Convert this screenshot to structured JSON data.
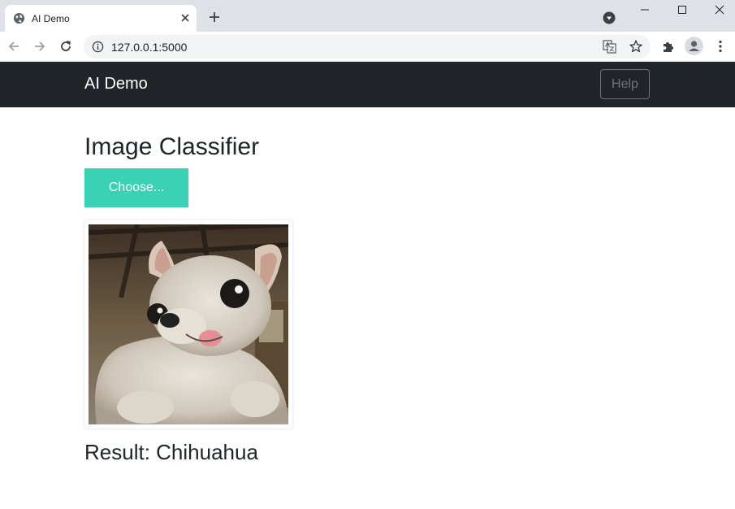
{
  "browser": {
    "tab_title": "AI Demo",
    "url": "127.0.0.1:5000",
    "icons": [
      "globe-icon",
      "close-icon",
      "plus-icon",
      "tab-search-icon",
      "minimize-icon",
      "maximize-icon",
      "window-close-icon",
      "back-icon",
      "forward-icon",
      "reload-icon",
      "info-icon",
      "translate-icon",
      "star-icon",
      "extensions-icon",
      "profile-icon",
      "menu-icon"
    ]
  },
  "navbar": {
    "brand": "AI Demo",
    "help_label": "Help",
    "background": "#212529"
  },
  "main": {
    "title": "Image Classifier",
    "choose_label": "Choose...",
    "choose_color": "#39d2b4",
    "result_prefix": "Result:",
    "result_value": "Chihuahua"
  }
}
